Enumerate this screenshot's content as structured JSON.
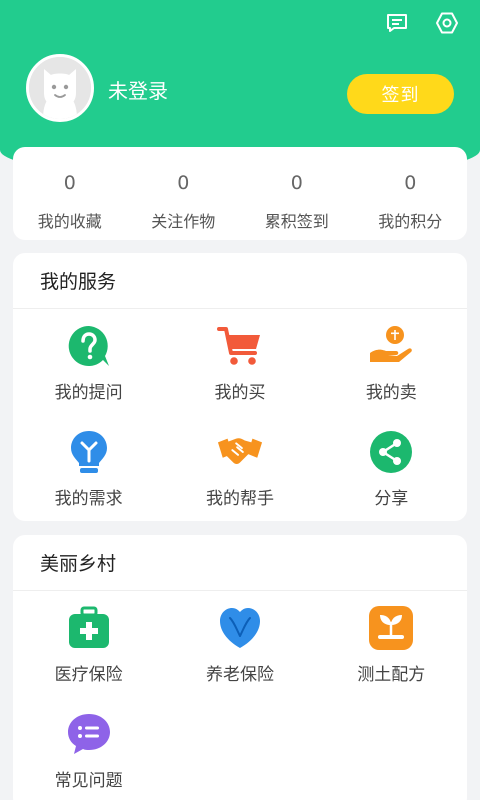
{
  "header": {
    "username": "未登录",
    "signin_label": "签到",
    "icons": [
      "message-icon",
      "settings-icon"
    ]
  },
  "stats": [
    {
      "value": "0",
      "label": "我的收藏"
    },
    {
      "value": "0",
      "label": "关注作物"
    },
    {
      "value": "0",
      "label": "累积签到"
    },
    {
      "value": "0",
      "label": "我的积分"
    }
  ],
  "services": {
    "title": "我的服务",
    "items": [
      {
        "label": "我的提问",
        "icon": "question-icon"
      },
      {
        "label": "我的买",
        "icon": "cart-icon"
      },
      {
        "label": "我的卖",
        "icon": "sell-hand-icon"
      },
      {
        "label": "我的需求",
        "icon": "lightbulb-icon"
      },
      {
        "label": "我的帮手",
        "icon": "handshake-icon"
      },
      {
        "label": "分享",
        "icon": "share-icon"
      }
    ]
  },
  "village": {
    "title": "美丽乡村",
    "items": [
      {
        "label": "医疗保险",
        "icon": "medical-kit-icon"
      },
      {
        "label": "养老保险",
        "icon": "heart-care-icon"
      },
      {
        "label": "测土配方",
        "icon": "soil-plant-icon"
      },
      {
        "label": "常见问题",
        "icon": "faq-chat-icon"
      }
    ]
  },
  "colors": {
    "brand_green": "#22cc8e",
    "signin_yellow": "#ffd91a"
  }
}
